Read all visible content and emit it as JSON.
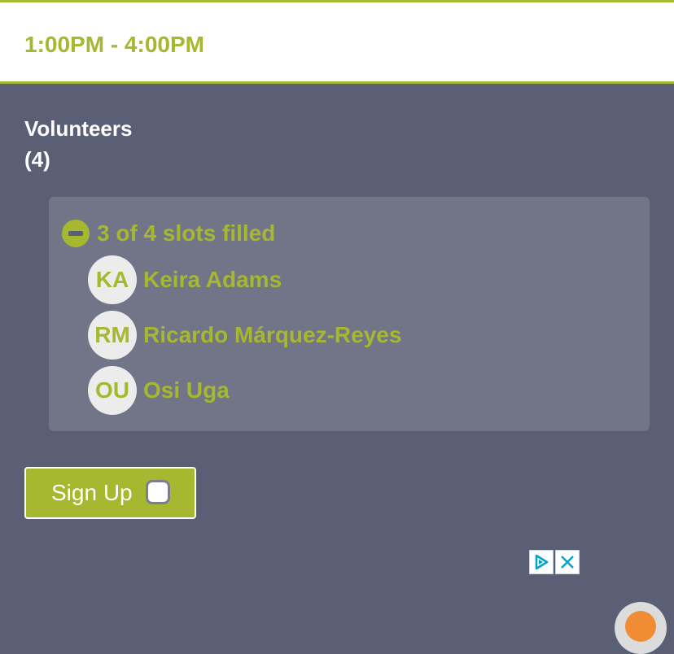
{
  "header": {
    "time_range": "1:00PM - 4:00PM"
  },
  "volunteers_section": {
    "title": "Volunteers",
    "count": "(4)"
  },
  "slots": {
    "summary": "3 of 4 slots filled",
    "volunteers": [
      {
        "initials": "KA",
        "name": "Keira Adams"
      },
      {
        "initials": "RM",
        "name": "Ricardo Márquez-Reyes"
      },
      {
        "initials": "OU",
        "name": "Osi Uga"
      }
    ]
  },
  "signup": {
    "label": "Sign Up",
    "checked": false
  },
  "colors": {
    "accent": "#a5b82f",
    "background": "#5b5f75",
    "panel": "#717587",
    "ad_icon": "#00a4c8"
  },
  "icons": {
    "collapse": "minus-circle-icon",
    "ad_choices": "ad-choices-icon",
    "ad_close": "close-icon",
    "fab": "assistant-icon"
  }
}
